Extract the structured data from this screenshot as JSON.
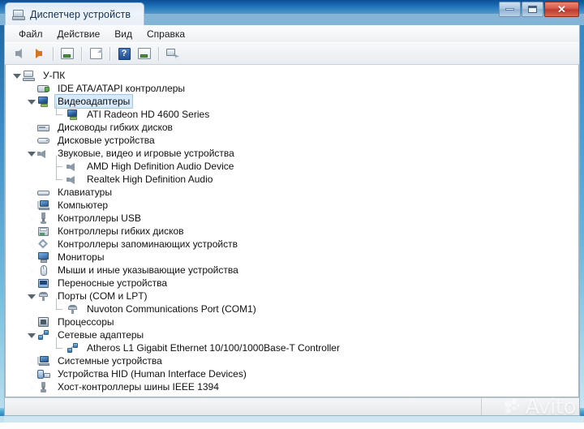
{
  "window": {
    "title": "Диспетчер устройств",
    "title_icon": "device-manager-icon",
    "controls": {
      "minimize": "minimize-icon",
      "maximize": "maximize-icon",
      "close": "✕"
    }
  },
  "menubar": {
    "items": [
      {
        "label": "Файл"
      },
      {
        "label": "Действие"
      },
      {
        "label": "Вид"
      },
      {
        "label": "Справка"
      }
    ]
  },
  "toolbar": {
    "buttons": [
      {
        "name": "back-button",
        "icon": "arrow-left-icon"
      },
      {
        "name": "forward-button",
        "icon": "arrow-right-icon"
      },
      {
        "name": "properties-button",
        "icon": "properties-icon"
      },
      {
        "name": "update-driver-button",
        "icon": "update-driver-icon"
      },
      {
        "name": "help-button",
        "icon": "help-icon",
        "glyph": "?"
      },
      {
        "name": "show-hidden-button",
        "icon": "show-hidden-icon"
      },
      {
        "name": "scan-hardware-button",
        "icon": "scan-hardware-icon"
      }
    ]
  },
  "tree": {
    "root": {
      "label": "У-ПК",
      "icon": "computer-icon",
      "expanded": true
    },
    "nodes": [
      {
        "label": "IDE ATA/ATAPI контроллеры",
        "icon": "ide-controller-icon",
        "state": "collapsed",
        "selected": false
      },
      {
        "label": "Видеоадаптеры",
        "icon": "display-adapter-icon",
        "state": "expanded",
        "selected": true,
        "children": [
          {
            "label": "ATI Radeon HD 4600 Series",
            "icon": "display-adapter-icon"
          }
        ]
      },
      {
        "label": "Дисководы гибких дисков",
        "icon": "floppy-drive-icon",
        "state": "collapsed",
        "selected": false
      },
      {
        "label": "Дисковые устройства",
        "icon": "disk-drive-icon",
        "state": "collapsed",
        "selected": false
      },
      {
        "label": "Звуковые, видео и игровые устройства",
        "icon": "sound-device-icon",
        "state": "expanded",
        "selected": false,
        "children": [
          {
            "label": "AMD High Definition Audio Device",
            "icon": "sound-device-icon"
          },
          {
            "label": "Realtek High Definition Audio",
            "icon": "sound-device-icon"
          }
        ]
      },
      {
        "label": "Клавиатуры",
        "icon": "keyboard-icon",
        "state": "collapsed",
        "selected": false
      },
      {
        "label": "Компьютер",
        "icon": "computer-node-icon",
        "state": "collapsed",
        "selected": false
      },
      {
        "label": "Контроллеры USB",
        "icon": "usb-controller-icon",
        "state": "collapsed",
        "selected": false
      },
      {
        "label": "Контроллеры гибких дисков",
        "icon": "floppy-controller-icon",
        "state": "collapsed",
        "selected": false
      },
      {
        "label": "Контроллеры запоминающих устройств",
        "icon": "storage-controller-icon",
        "state": "collapsed",
        "selected": false
      },
      {
        "label": "Мониторы",
        "icon": "monitor-icon",
        "state": "collapsed",
        "selected": false
      },
      {
        "label": "Мыши и иные указывающие устройства",
        "icon": "mouse-icon",
        "state": "collapsed",
        "selected": false
      },
      {
        "label": "Переносные устройства",
        "icon": "portable-device-icon",
        "state": "collapsed",
        "selected": false
      },
      {
        "label": "Порты (COM и LPT)",
        "icon": "com-port-icon",
        "state": "expanded",
        "selected": false,
        "children": [
          {
            "label": "Nuvoton Communications Port (COM1)",
            "icon": "com-port-icon"
          }
        ]
      },
      {
        "label": "Процессоры",
        "icon": "processor-icon",
        "state": "collapsed",
        "selected": false
      },
      {
        "label": "Сетевые адаптеры",
        "icon": "network-adapter-icon",
        "state": "expanded",
        "selected": false,
        "children": [
          {
            "label": "Atheros L1 Gigabit Ethernet 10/100/1000Base-T Controller",
            "icon": "network-adapter-icon"
          }
        ]
      },
      {
        "label": "Системные устройства",
        "icon": "system-device-icon",
        "state": "collapsed",
        "selected": false
      },
      {
        "label": "Устройства HID (Human Interface Devices)",
        "icon": "hid-device-icon",
        "state": "collapsed",
        "selected": false
      },
      {
        "label": "Хост-контроллеры шины IEEE 1394",
        "icon": "ieee1394-icon",
        "state": "collapsed",
        "selected": false
      }
    ]
  },
  "statusbar": {
    "text": ""
  },
  "watermark": {
    "text": "Avito"
  },
  "colors": {
    "title_blue": "#1464ad",
    "close_red": "#bc3a2c",
    "selection": "#d6eafb",
    "frame_glass": "#3e95d2"
  }
}
